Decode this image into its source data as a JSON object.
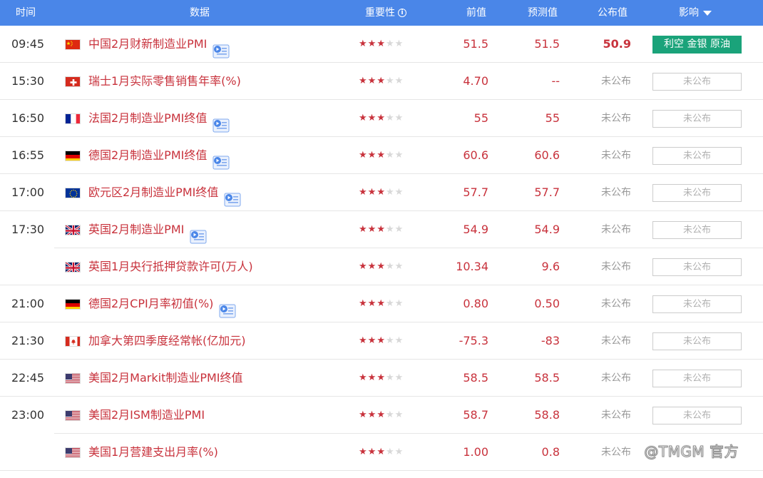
{
  "header": {
    "time": "时间",
    "data": "数据",
    "importance": "重要性",
    "previous": "前值",
    "forecast": "预测值",
    "actual": "公布值",
    "impact": "影响"
  },
  "colors": {
    "accent": "#4a86e8",
    "value_red": "#c8323c",
    "impact_green": "#1aa37a",
    "muted": "#999999"
  },
  "rows": [
    {
      "time": "09:45",
      "flag": "cn",
      "name": "中国2月财新制造业PMI",
      "video": true,
      "stars": 3,
      "prev": "51.5",
      "forecast": "51.5",
      "actual": "50.9",
      "impact": "利空 金银 原油",
      "released": true
    },
    {
      "time": "15:30",
      "flag": "ch",
      "name": "瑞士1月实际零售销售年率(%)",
      "video": false,
      "stars": 3,
      "prev": "4.70",
      "forecast": "--",
      "actual": "未公布",
      "impact": "未公布",
      "released": false
    },
    {
      "time": "16:50",
      "flag": "fr",
      "name": "法国2月制造业PMI终值",
      "video": true,
      "stars": 3,
      "prev": "55",
      "forecast": "55",
      "actual": "未公布",
      "impact": "未公布",
      "released": false
    },
    {
      "time": "16:55",
      "flag": "de",
      "name": "德国2月制造业PMI终值",
      "video": true,
      "stars": 3,
      "prev": "60.6",
      "forecast": "60.6",
      "actual": "未公布",
      "impact": "未公布",
      "released": false
    },
    {
      "time": "17:00",
      "flag": "eu",
      "name": "欧元区2月制造业PMI终值",
      "video": true,
      "stars": 3,
      "prev": "57.7",
      "forecast": "57.7",
      "actual": "未公布",
      "impact": "未公布",
      "released": false
    },
    {
      "time": "17:30",
      "flag": "gb",
      "name": "英国2月制造业PMI",
      "video": true,
      "stars": 3,
      "prev": "54.9",
      "forecast": "54.9",
      "actual": "未公布",
      "impact": "未公布",
      "released": false
    },
    {
      "time": "",
      "flag": "gb",
      "name": "英国1月央行抵押贷款许可(万人)",
      "video": false,
      "stars": 3,
      "prev": "10.34",
      "forecast": "9.6",
      "actual": "未公布",
      "impact": "未公布",
      "released": false
    },
    {
      "time": "21:00",
      "flag": "de",
      "name": "德国2月CPI月率初值(%)",
      "video": true,
      "stars": 3,
      "prev": "0.80",
      "forecast": "0.50",
      "actual": "未公布",
      "impact": "未公布",
      "released": false
    },
    {
      "time": "21:30",
      "flag": "ca",
      "name": "加拿大第四季度经常帐(亿加元)",
      "video": false,
      "stars": 3,
      "prev": "-75.3",
      "forecast": "-83",
      "actual": "未公布",
      "impact": "未公布",
      "released": false
    },
    {
      "time": "22:45",
      "flag": "us",
      "name": "美国2月Markit制造业PMI终值",
      "video": false,
      "stars": 3,
      "prev": "58.5",
      "forecast": "58.5",
      "actual": "未公布",
      "impact": "未公布",
      "released": false
    },
    {
      "time": "23:00",
      "flag": "us",
      "name": "美国2月ISM制造业PMI",
      "video": false,
      "stars": 3,
      "prev": "58.7",
      "forecast": "58.8",
      "actual": "未公布",
      "impact": "未公布",
      "released": false
    },
    {
      "time": "",
      "flag": "us",
      "name": "美国1月营建支出月率(%)",
      "video": false,
      "stars": 3,
      "prev": "1.00",
      "forecast": "0.8",
      "actual": "未公布",
      "impact": "",
      "released": false
    }
  ],
  "watermark": "@TMGM 官方"
}
